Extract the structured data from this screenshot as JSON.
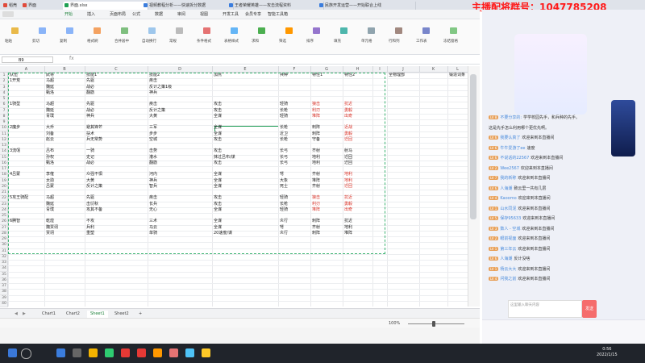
{
  "browser": {
    "tabs": [
      {
        "label": "稻壳",
        "color": "#e04b3c"
      },
      {
        "label": "界面",
        "color": "#e04b3c"
      },
      {
        "label": "界面.xlsx",
        "color": "#1fa053"
      },
      {
        "label": "视频教程分析——快速拆分数据",
        "color": "#3b7ddd"
      },
      {
        "label": "王者荣耀英雄——攻击流程资料",
        "color": "#3b7ddd"
      },
      {
        "label": "民族开发运营——开始联合上线",
        "color": "#3b7ddd"
      }
    ]
  },
  "streamer_banner": "主播配将群号：1047785208",
  "ribbon": {
    "menu": [
      "开始",
      "插入",
      "页面布局",
      "公式",
      "数据",
      "审阅",
      "视图",
      "开发工具",
      "会员专享",
      "智能工具箱"
    ],
    "active_menu": "开始",
    "tools": [
      "粘贴",
      "剪切",
      "复制",
      "格式刷",
      "合并居中",
      "自动换行",
      "常规",
      "条件格式",
      "表格样式",
      "求和",
      "筛选",
      "排序",
      "填充",
      "单元格",
      "行和列",
      "工作表",
      "冻结窗格"
    ]
  },
  "formula_bar": {
    "name_box": "B9",
    "fx": "fx"
  },
  "columns": [
    "A",
    "B",
    "C",
    "D",
    "E",
    "F",
    "G",
    "H",
    "I",
    "J",
    "K",
    "L"
  ],
  "rows": [
    "1",
    "2",
    "3",
    "4",
    "5",
    "6",
    "7",
    "8",
    "9",
    "10",
    "11",
    "12",
    "13",
    "14",
    "15",
    "16",
    "17",
    "18",
    "19",
    "20",
    "21",
    "22",
    "23",
    "24",
    "25",
    "26",
    "27",
    "28",
    "29",
    "30",
    "31",
    "32",
    "33",
    "34",
    "35",
    "36",
    "37",
    "38",
    "39",
    "40"
  ],
  "headers": [
    "队伍",
    "武将",
    "技能1",
    "技能2",
    "加点",
    "兵种",
    "特性1",
    "特性2",
    "",
    "全物理部",
    "",
    "锻造词条"
  ],
  "table": [
    {
      "r": 2,
      "c": [
        0
      ],
      "cells": [
        "1开荒"
      ]
    },
    {
      "r": 2,
      "c": [
        1,
        2,
        3
      ],
      "cells": [
        "马超",
        "先驱",
        "疾击"
      ]
    },
    {
      "r": 3,
      "c": [
        1,
        2,
        3
      ],
      "cells": [
        "魏延",
        "战必",
        "反计之策1级"
      ]
    },
    {
      "r": 4,
      "c": [
        1,
        2,
        3
      ],
      "cells": [
        "甄洛",
        "翻筋",
        "神兵"
      ]
    },
    {
      "r": 6,
      "c": [
        0
      ],
      "cells": [
        "1骑型"
      ]
    },
    {
      "r": 6,
      "c": [
        1,
        2,
        3,
        4,
        5
      ],
      "cells": [
        "马超",
        "先驱",
        "疾击",
        "攻击",
        "轻骑"
      ]
    },
    {
      "r": 7,
      "c": [
        1,
        2,
        3,
        4,
        5
      ],
      "cells": [
        "魏延",
        "战必",
        "反计之策",
        "攻击",
        "长枪"
      ]
    },
    {
      "r": 8,
      "c": [
        1,
        2,
        3,
        4,
        5
      ],
      "cells": [
        "青璞",
        "神兵",
        "大黄",
        "全谋",
        "轻骑"
      ]
    },
    {
      "r": 10,
      "c": [
        0
      ],
      "cells": [
        "2魔步"
      ]
    },
    {
      "r": 10,
      "c": [
        1,
        2,
        3,
        4,
        5,
        6
      ],
      "cells": [
        "大乔",
        "避其锋芒",
        "三军",
        "全谋",
        "长枪",
        "刺阵"
      ]
    },
    {
      "r": 11,
      "c": [
        1,
        2,
        3,
        4,
        5,
        6
      ],
      "cells": [
        "刘备",
        "扶术",
        "步步",
        "全谋",
        "近卫",
        "刺阵"
      ]
    },
    {
      "r": 12,
      "c": [
        1,
        2,
        3,
        4,
        5,
        6
      ],
      "cells": [
        "赵云",
        "兵无常势",
        "空城",
        "攻击",
        "长枪",
        "守备"
      ]
    },
    {
      "r": 14,
      "c": [
        0
      ],
      "cells": [
        "3流氓"
      ]
    },
    {
      "r": 14,
      "c": [
        1,
        2,
        3,
        4,
        5,
        6,
        7
      ],
      "cells": [
        "吕布",
        "一骑",
        "击势",
        "攻击",
        "长弓",
        "齐射",
        "射马"
      ]
    },
    {
      "r": 15,
      "c": [
        1,
        2,
        3,
        4,
        5,
        6,
        7
      ],
      "cells": [
        "孙权",
        "史记",
        "灌水",
        "抹过吕布/谋",
        "长弓",
        "地利",
        "迁回"
      ]
    },
    {
      "r": 16,
      "c": [
        1,
        2,
        3,
        4,
        5,
        6,
        7
      ],
      "cells": [
        "甄洛",
        "战必",
        "翻筋",
        "攻击",
        "长弓",
        "地利",
        "迁回"
      ]
    },
    {
      "r": 18,
      "c": [
        0
      ],
      "cells": [
        "4吕蒙"
      ]
    },
    {
      "r": 18,
      "c": [
        1,
        2,
        3,
        4,
        5,
        6
      ],
      "cells": [
        "李傕",
        "众强不惧",
        "河内",
        "全谋",
        "弩",
        "齐射"
      ]
    },
    {
      "r": 19,
      "c": [
        1,
        2,
        3,
        4,
        5,
        6
      ],
      "cells": [
        "太勋",
        "大黄",
        "神兵",
        "全谋",
        "大象",
        "堆阵"
      ]
    },
    {
      "r": 20,
      "c": [
        1,
        2,
        3,
        4,
        5,
        6
      ],
      "cells": [
        "吕蒙",
        "反计之策",
        "智兵",
        "全谋",
        "死士",
        "齐射"
      ]
    },
    {
      "r": 22,
      "c": [
        0
      ],
      "cells": [
        "5攻王骑配"
      ]
    },
    {
      "r": 22,
      "c": [
        1,
        2,
        3,
        4,
        5
      ],
      "cells": [
        "马超",
        "先驱",
        "疾击",
        "攻击",
        "轻骑"
      ]
    },
    {
      "r": 23,
      "c": [
        1,
        2,
        3,
        4,
        5
      ],
      "cells": [
        "魏延",
        "击衍秋",
        "长兵",
        "攻击",
        "长枪"
      ]
    },
    {
      "r": 24,
      "c": [
        1,
        2,
        3,
        4,
        5
      ],
      "cells": [
        "青璞",
        "攻其不备",
        "无心",
        "全谋",
        "轻骑"
      ]
    },
    {
      "r": 26,
      "c": [
        0
      ],
      "cells": [
        "6腾智"
      ]
    },
    {
      "r": 26,
      "c": [
        1,
        2,
        3,
        4,
        5,
        6,
        7
      ],
      "cells": [
        "乾煌",
        "不攻",
        "三术",
        "全谋",
        "炎行",
        "刺阵",
        "抗近"
      ]
    },
    {
      "r": 27,
      "c": [
        1,
        2,
        3,
        4,
        5,
        6,
        7
      ],
      "cells": [
        "魏贾诩",
        "兵利",
        "马云",
        "全谋",
        "弩",
        "齐射",
        "地利"
      ]
    },
    {
      "r": 28,
      "c": [
        1,
        2,
        3,
        4,
        5,
        6,
        7
      ],
      "cells": [
        "贾诩",
        "重塑",
        "单骑",
        "20速度/谋",
        "炎行",
        "刺阵",
        "堆阵"
      ]
    }
  ],
  "red_cells": [
    {
      "r": 6,
      "c": 6,
      "text": "狼击"
    },
    {
      "r": 6,
      "c": 7,
      "text": "抗近"
    },
    {
      "r": 7,
      "c": 6,
      "text": "利刃"
    },
    {
      "r": 7,
      "c": 7,
      "text": "勇毅"
    },
    {
      "r": 8,
      "c": 6,
      "text": "堆阵"
    },
    {
      "r": 8,
      "c": 7,
      "text": "出奇"
    },
    {
      "r": 10,
      "c": 7,
      "text": "近战"
    },
    {
      "r": 11,
      "c": 7,
      "text": "勇毅"
    },
    {
      "r": 12,
      "c": 7,
      "text": "迁回"
    },
    {
      "r": 18,
      "c": 7,
      "text": "地利"
    },
    {
      "r": 19,
      "c": 7,
      "text": "地利"
    },
    {
      "r": 20,
      "c": 7,
      "text": "迁回"
    },
    {
      "r": 22,
      "c": 6,
      "text": "狼击"
    },
    {
      "r": 22,
      "c": 7,
      "text": "抗近"
    },
    {
      "r": 23,
      "c": 6,
      "text": "利刃"
    },
    {
      "r": 23,
      "c": 7,
      "text": "勇毅"
    },
    {
      "r": 24,
      "c": 6,
      "text": "堆阵"
    },
    {
      "r": 24,
      "c": 7,
      "text": "出奇"
    }
  ],
  "sheets": [
    "Chart1",
    "Chart2",
    "Sheet1",
    "Sheet2",
    "+"
  ],
  "active_sheet": "Sheet1",
  "status": {
    "zoom": "100%"
  },
  "live": {
    "chat": [
      {
        "lv": "LV 8",
        "user": "不要分享的:",
        "msg": "学学校园先手，和兵种的先手。"
      },
      {
        "lv": "",
        "user": "",
        "msg": "这是先手怎么利用哪个更优先啊。"
      },
      {
        "lv": "LV 6",
        "user": "我要认真了",
        "msg": "欢迎来到本直播间"
      },
      {
        "lv": "LV 6",
        "user": "牛牛爱游了ee",
        "msg": "速度"
      },
      {
        "lv": "LV 6",
        "user": "不说话的22567",
        "msg": "欢迎来到本直播间"
      },
      {
        "lv": "LV 2",
        "user": "Wee2567",
        "msg": "欢迎来到本直播间"
      },
      {
        "lv": "LV 7",
        "user": "我的新称",
        "msg": "欢迎来到本直播间"
      },
      {
        "lv": "LV 6",
        "user": "人海潮",
        "msg": "致云里一共有几层"
      },
      {
        "lv": "LV 4",
        "user": "Kaoomo",
        "msg": "欢迎来到本直播间"
      },
      {
        "lv": "LV 1",
        "user": "山水同泥",
        "msg": "欢迎来到本直播间"
      },
      {
        "lv": "LV 5",
        "user": "保存95633",
        "msg": "欢迎来到本直播间"
      },
      {
        "lv": "LV 3",
        "user": "数人 - 空城",
        "msg": "欢迎来到本直播间"
      },
      {
        "lv": "LV 2",
        "user": "眼前视面",
        "msg": "欢迎来到本直播间"
      },
      {
        "lv": "LV 1",
        "user": "第三年云",
        "msg": "欢迎来到本直播间"
      },
      {
        "lv": "LV 6",
        "user": "人海潮",
        "msg": "反计没啥"
      },
      {
        "lv": "LV 1",
        "user": "杨云大大",
        "msg": "欢迎来到本直播间"
      },
      {
        "lv": "LV 4",
        "user": "问我之前",
        "msg": "欢迎来到本直播间"
      }
    ],
    "input_placeholder": "这里输入聊天内容",
    "send": "发送"
  },
  "taskbar": {
    "time": "0:56",
    "date": "2022/1/15"
  }
}
